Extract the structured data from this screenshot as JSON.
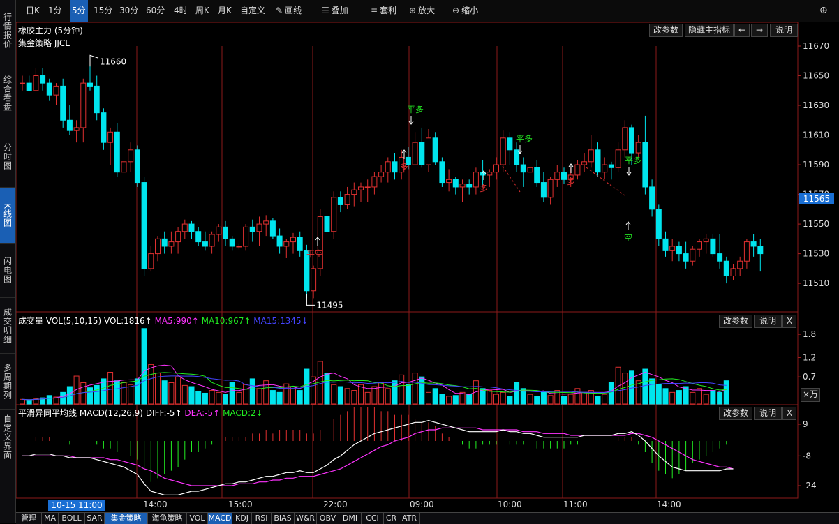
{
  "sidebar": [
    {
      "label": "行情报价",
      "active": false
    },
    {
      "label": "综合看盘",
      "active": false
    },
    {
      "label": "分时图",
      "active": false
    },
    {
      "label": "K线图",
      "active": true
    },
    {
      "label": "闪电图",
      "active": false
    },
    {
      "label": "成交明细",
      "active": false
    },
    {
      "label": "多周期列",
      "active": false
    },
    {
      "label": "自定义界面",
      "active": false
    }
  ],
  "toolbar": {
    "periods": [
      "日K",
      "1分",
      "5分",
      "15分",
      "30分",
      "60分",
      "4时",
      "周K",
      "月K",
      "自定义"
    ],
    "active_period": "5分",
    "draw_label": "画线",
    "overlay_label": "叠加",
    "arbitrage_label": "套利",
    "zoom_in_label": "放大",
    "zoom_out_label": "缩小"
  },
  "main_panel": {
    "title": "橡胶主力 (5分钟)",
    "strategy": "集金策略 JJCL",
    "buttons": {
      "params": "改参数",
      "hide": "隐藏主指标",
      "left": "←",
      "right": "→",
      "explain": "说明"
    },
    "current_price": "11565",
    "high_label": "11660",
    "low_label": "11495"
  },
  "volume_panel": {
    "title": "成交量",
    "vol_prefix": "VOL(5,10,15)",
    "vol": "VOL:1816↑",
    "ma5": "MA5:990↑",
    "ma10": "MA10:967↑",
    "ma15": "MA15:1345↓",
    "unit": "×万",
    "buttons": {
      "params": "改参数",
      "explain": "说明",
      "close": "X"
    }
  },
  "macd_panel": {
    "title": "平滑异同平均线",
    "macd_prefix": "MACD(12,26,9)",
    "diff": "DIFF:-5↑",
    "dea": "DEA:-5↑",
    "macd": "MACD:2↓",
    "buttons": {
      "params": "改参数",
      "explain": "说明",
      "close": "X"
    }
  },
  "time_axis": {
    "cursor_label": "10-15 11:00",
    "labels": [
      "14:00",
      "15:00",
      "22:00",
      "09:00",
      "10:00",
      "11:00",
      "14:00"
    ]
  },
  "bottom_tabs": [
    "管理",
    "MA",
    "BOLL",
    "SAR",
    "集金策略",
    "海龟策略",
    "VOL",
    "MACD",
    "KDJ",
    "RSI",
    "BIAS",
    "W&R",
    "OBV",
    "DMI",
    "CCI",
    "CR",
    "ATR"
  ],
  "bottom_active": [
    "集金策略",
    "MACD"
  ],
  "colors": {
    "up": "#e03030",
    "down": "#00e5ee",
    "bg": "#000000",
    "grid": "#8b1a1a",
    "accent": "#1a6fd4",
    "ma5": "#ff33ff",
    "ma10": "#22ee22",
    "ma15": "#4444ff",
    "dea": "#ff33ff",
    "diff": "#ffffff"
  },
  "chart_data": [
    {
      "type": "candlestick",
      "title": "橡胶主力 (5分钟)",
      "ylim": [
        11495,
        11670
      ],
      "yticks": [
        11670,
        11650,
        11630,
        11610,
        11590,
        11570,
        11550,
        11530,
        11510
      ],
      "ohlc": [
        [
          11645,
          11650,
          11640,
          11645
        ],
        [
          11645,
          11650,
          11640,
          11640
        ],
        [
          11640,
          11655,
          11640,
          11650
        ],
        [
          11650,
          11655,
          11640,
          11645
        ],
        [
          11645,
          11648,
          11633,
          11637
        ],
        [
          11637,
          11645,
          11630,
          11643
        ],
        [
          11643,
          11648,
          11615,
          11620
        ],
        [
          11620,
          11630,
          11610,
          11613
        ],
        [
          11613,
          11620,
          11605,
          11615
        ],
        [
          11615,
          11648,
          11605,
          11645
        ],
        [
          11645,
          11660,
          11640,
          11643
        ],
        [
          11643,
          11650,
          11620,
          11625
        ],
        [
          11625,
          11628,
          11600,
          11605
        ],
        [
          11605,
          11615,
          11590,
          11612
        ],
        [
          11612,
          11618,
          11582,
          11585
        ],
        [
          11585,
          11595,
          11580,
          11592
        ],
        [
          11592,
          11605,
          11585,
          11600
        ],
        [
          11600,
          11603,
          11575,
          11578
        ],
        [
          11578,
          11582,
          11515,
          11520
        ],
        [
          11520,
          11535,
          11518,
          11530
        ],
        [
          11530,
          11542,
          11525,
          11540
        ],
        [
          11540,
          11545,
          11530,
          11535
        ],
        [
          11535,
          11545,
          11530,
          11538
        ],
        [
          11538,
          11548,
          11530,
          11545
        ],
        [
          11545,
          11553,
          11540,
          11550
        ],
        [
          11550,
          11552,
          11540,
          11545
        ],
        [
          11545,
          11548,
          11535,
          11538
        ],
        [
          11538,
          11545,
          11532,
          11535
        ],
        [
          11535,
          11545,
          11530,
          11543
        ],
        [
          11543,
          11550,
          11538,
          11548
        ],
        [
          11548,
          11552,
          11535,
          11540
        ],
        [
          11540,
          11542,
          11532,
          11535
        ],
        [
          11535,
          11537,
          11533,
          11535
        ],
        [
          11535,
          11550,
          11532,
          11548
        ],
        [
          11548,
          11553,
          11538,
          11545
        ],
        [
          11545,
          11555,
          11535,
          11550
        ],
        [
          11550,
          11556,
          11542,
          11552
        ],
        [
          11552,
          11554,
          11540,
          11542
        ],
        [
          11542,
          11547,
          11530,
          11535
        ],
        [
          11535,
          11540,
          11527,
          11538
        ],
        [
          11538,
          11544,
          11530,
          11541
        ],
        [
          11541,
          11545,
          11528,
          11532
        ],
        [
          11532,
          11536,
          11500,
          11505
        ],
        [
          11505,
          11522,
          11500,
          11520
        ],
        [
          11520,
          11560,
          11515,
          11555
        ],
        [
          11555,
          11568,
          11535,
          11545
        ],
        [
          11545,
          11572,
          11540,
          11568
        ],
        [
          11568,
          11572,
          11558,
          11563
        ],
        [
          11563,
          11575,
          11560,
          11570
        ],
        [
          11570,
          11578,
          11562,
          11573
        ],
        [
          11573,
          11578,
          11565,
          11575
        ],
        [
          11575,
          11580,
          11565,
          11575
        ],
        [
          11575,
          11585,
          11570,
          11582
        ],
        [
          11582,
          11590,
          11578,
          11585
        ],
        [
          11585,
          11595,
          11578,
          11592
        ],
        [
          11592,
          11598,
          11580,
          11585
        ],
        [
          11585,
          11600,
          11580,
          11595
        ],
        [
          11595,
          11602,
          11587,
          11590
        ],
        [
          11590,
          11612,
          11590,
          11605
        ],
        [
          11605,
          11615,
          11588,
          11590
        ],
        [
          11590,
          11614,
          11585,
          11608
        ],
        [
          11608,
          11612,
          11590,
          11592
        ],
        [
          11592,
          11595,
          11575,
          11578
        ],
        [
          11578,
          11587,
          11572,
          11580
        ],
        [
          11580,
          11582,
          11570,
          11575
        ],
        [
          11575,
          11580,
          11565,
          11577
        ],
        [
          11577,
          11580,
          11570,
          11575
        ],
        [
          11575,
          11588,
          11570,
          11585
        ],
        [
          11585,
          11593,
          11575,
          11583
        ],
        [
          11583,
          11587,
          11575,
          11585
        ],
        [
          11585,
          11595,
          11580,
          11590
        ],
        [
          11590,
          11613,
          11585,
          11608
        ],
        [
          11608,
          11612,
          11590,
          11600
        ],
        [
          11600,
          11605,
          11585,
          11590
        ],
        [
          11590,
          11595,
          11575,
          11585
        ],
        [
          11585,
          11592,
          11580,
          11588
        ],
        [
          11588,
          11593,
          11575,
          11578
        ],
        [
          11578,
          11585,
          11565,
          11568
        ],
        [
          11568,
          11582,
          11563,
          11580
        ],
        [
          11580,
          11590,
          11575,
          11585
        ],
        [
          11585,
          11588,
          11577,
          11580
        ],
        [
          11580,
          11588,
          11575,
          11583
        ],
        [
          11583,
          11593,
          11580,
          11590
        ],
        [
          11590,
          11598,
          11585,
          11592
        ],
        [
          11592,
          11610,
          11588,
          11600
        ],
        [
          11600,
          11605,
          11582,
          11585
        ],
        [
          11585,
          11595,
          11580,
          11590
        ],
        [
          11590,
          11592,
          11580,
          11588
        ],
        [
          11588,
          11605,
          11585,
          11600
        ],
        [
          11600,
          11620,
          11595,
          11615
        ],
        [
          11615,
          11617,
          11590,
          11598
        ],
        [
          11598,
          11610,
          11595,
          11605
        ],
        [
          11605,
          11623,
          11570,
          11575
        ],
        [
          11575,
          11580,
          11555,
          11560
        ],
        [
          11560,
          11563,
          11535,
          11540
        ],
        [
          11540,
          11545,
          11528,
          11532
        ],
        [
          11532,
          11540,
          11525,
          11535
        ],
        [
          11535,
          11538,
          11525,
          11530
        ],
        [
          11530,
          11538,
          11520,
          11525
        ],
        [
          11525,
          11535,
          11522,
          11533
        ],
        [
          11533,
          11540,
          11528,
          11538
        ],
        [
          11538,
          11543,
          11530,
          11540
        ],
        [
          11540,
          11543,
          11528,
          11530
        ],
        [
          11530,
          11543,
          11520,
          11525
        ],
        [
          11525,
          11528,
          11510,
          11515
        ],
        [
          11515,
          11523,
          11512,
          11520
        ],
        [
          11520,
          11528,
          11515,
          11525
        ],
        [
          11525,
          11540,
          11520,
          11538
        ],
        [
          11538,
          11543,
          11528,
          11535
        ],
        [
          11535,
          11540,
          11518,
          11530
        ]
      ],
      "annotations": [
        "11660",
        "11495",
        "平多",
        "平多",
        "平多",
        "多",
        "多",
        "多",
        "平空",
        "空"
      ]
    },
    {
      "type": "bar",
      "title": "成交量",
      "ylim": [
        0,
        2.0
      ],
      "yticks": [
        1.8,
        1.2,
        0.7
      ],
      "unit": "×万",
      "values": [
        0.12,
        0.1,
        0.14,
        0.16,
        0.22,
        0.18,
        0.3,
        0.45,
        0.72,
        0.55,
        0.42,
        0.48,
        0.65,
        0.82,
        0.6,
        0.55,
        0.5,
        0.65,
        1.95,
        1.02,
        0.8,
        0.6,
        0.55,
        0.7,
        0.48,
        0.45,
        0.32,
        0.28,
        0.35,
        0.3,
        0.25,
        0.55,
        0.3,
        0.5,
        0.65,
        0.4,
        0.6,
        0.35,
        0.3,
        0.52,
        0.45,
        0.35,
        0.9,
        0.7,
        1.1,
        0.8,
        0.5,
        0.45,
        0.4,
        0.35,
        0.5,
        0.3,
        0.45,
        0.55,
        0.4,
        0.6,
        0.75,
        0.5,
        0.8,
        0.7,
        0.3,
        0.4,
        0.25,
        0.2,
        0.22,
        0.3,
        0.25,
        0.6,
        0.4,
        0.35,
        0.25,
        0.3,
        0.2,
        0.55,
        0.4,
        0.25,
        0.2,
        0.3,
        0.22,
        0.35,
        0.2,
        0.25,
        0.4,
        0.3,
        0.35,
        0.2,
        0.25,
        0.55,
        0.95,
        0.8,
        0.85,
        0.6,
        0.9,
        0.65,
        0.5,
        0.4,
        0.3,
        0.35,
        0.45,
        0.3,
        0.4,
        0.25,
        0.35,
        0.3,
        0.6
      ],
      "ma5": "990",
      "ma10": "967",
      "ma15": "1345"
    },
    {
      "type": "line",
      "title": "平滑异同平均线 MACD(12,26,9)",
      "ylim": [
        -30,
        12
      ],
      "yticks": [
        9,
        -8,
        -24
      ],
      "diff": [
        -8,
        -8,
        -7,
        -7,
        -7,
        -8,
        -8,
        -9,
        -9,
        -9,
        -9,
        -10,
        -11,
        -12,
        -13,
        -14,
        -16,
        -18,
        -23,
        -27,
        -28,
        -29,
        -29,
        -29,
        -28,
        -27,
        -27,
        -26,
        -25,
        -24,
        -23,
        -23,
        -22,
        -22,
        -21,
        -20,
        -19,
        -19,
        -18,
        -17,
        -17,
        -16,
        -17,
        -17,
        -15,
        -13,
        -10,
        -8,
        -5,
        -2,
        0,
        2,
        4,
        5,
        6,
        7,
        8,
        9,
        10,
        10,
        11,
        10,
        9,
        8,
        7,
        6,
        5,
        5,
        5,
        5,
        5,
        6,
        5,
        5,
        4,
        4,
        3,
        2,
        2,
        2,
        2,
        2,
        2,
        3,
        3,
        3,
        3,
        3,
        4,
        4,
        5,
        3,
        0,
        -4,
        -8,
        -11,
        -14,
        -15,
        -16,
        -16,
        -16,
        -16,
        -16,
        -16,
        -15,
        -15
      ],
      "dea": [
        -8,
        -8,
        -8,
        -8,
        -8,
        -8,
        -8,
        -8,
        -9,
        -9,
        -9,
        -9,
        -9,
        -10,
        -10,
        -11,
        -12,
        -13,
        -15,
        -16,
        -18,
        -20,
        -21,
        -22,
        -23,
        -24,
        -24,
        -24,
        -24,
        -24,
        -24,
        -24,
        -23,
        -23,
        -23,
        -22,
        -22,
        -21,
        -21,
        -20,
        -20,
        -19,
        -19,
        -19,
        -18,
        -17,
        -16,
        -15,
        -13,
        -11,
        -9,
        -7,
        -5,
        -3,
        -2,
        0,
        1,
        2,
        4,
        5,
        6,
        6,
        7,
        7,
        7,
        7,
        7,
        7,
        6,
        6,
        6,
        6,
        6,
        6,
        5,
        5,
        5,
        4,
        4,
        4,
        4,
        3,
        3,
        3,
        3,
        3,
        3,
        3,
        3,
        3,
        4,
        4,
        3,
        2,
        0,
        -2,
        -4,
        -6,
        -8,
        -10,
        -11,
        -12,
        -13,
        -14,
        -14,
        -15
      ],
      "macd_label": "MACD:2↓"
    }
  ]
}
